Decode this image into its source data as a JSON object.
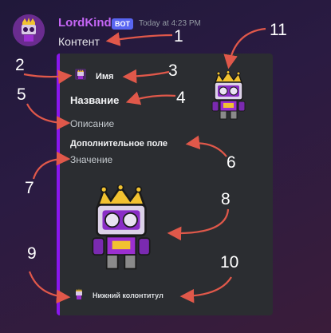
{
  "message": {
    "author": "LordKind",
    "bot_tag": "BOT",
    "timestamp": "Today at 4:23 PM",
    "content": "Контент"
  },
  "embed": {
    "author_name": "Имя",
    "title": "Название",
    "description": "Описание",
    "field_name": "Дополнительное поле",
    "field_value": "Значение",
    "footer_text": "Нижний колонтитул"
  },
  "annotations": [
    "1",
    "2",
    "3",
    "4",
    "5",
    "6",
    "7",
    "8",
    "9",
    "10",
    "11"
  ],
  "colors": {
    "author": "#c566f5",
    "bot_tag": "#5865f2",
    "embed_bar": "#8a16ef",
    "embed_bg": "#2b2d31",
    "arrow": "#e0584a"
  }
}
